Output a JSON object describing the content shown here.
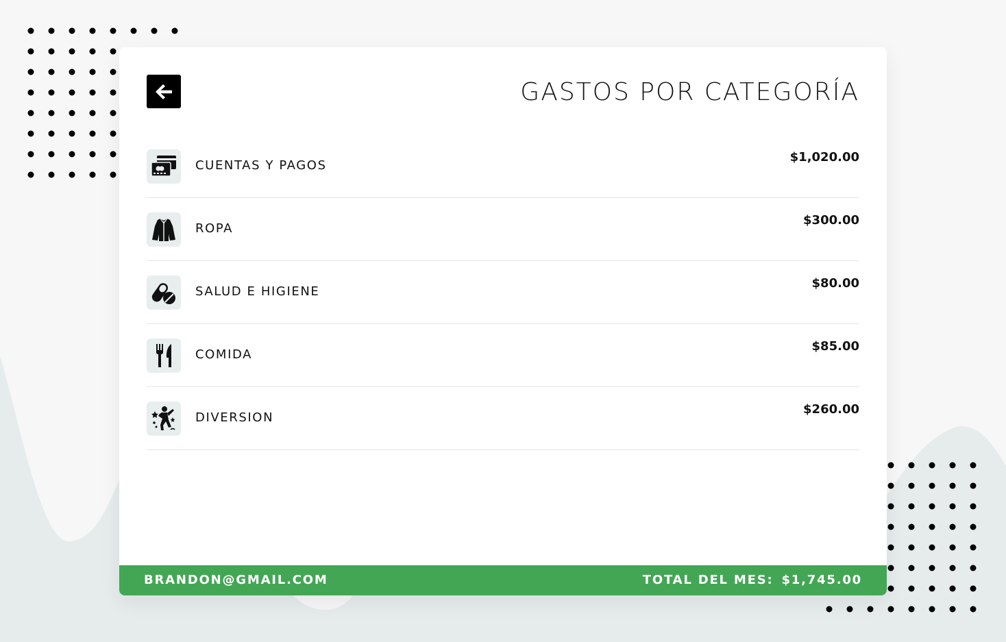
{
  "header": {
    "back_icon": "arrow-left-icon",
    "title": "GASTOS POR CATEGORÍA"
  },
  "categories": [
    {
      "icon": "bills-cards-icon",
      "label": "CUENTAS Y PAGOS",
      "amount": "$1,020.00"
    },
    {
      "icon": "jacket-icon",
      "label": "ROPA",
      "amount": "$300.00"
    },
    {
      "icon": "pills-icon",
      "label": "SALUD E HIGIENE",
      "amount": "$80.00"
    },
    {
      "icon": "fork-knife-icon",
      "label": "COMIDA",
      "amount": "$85.00"
    },
    {
      "icon": "dancing-person-icon",
      "label": "DIVERSION",
      "amount": "$260.00"
    }
  ],
  "footer": {
    "email": "BRANDON@GMAIL.COM",
    "total_label": "TOTAL DEL MES:",
    "total_value": "$1,745.00"
  },
  "colors": {
    "accent": "#43a655",
    "icon_bg": "#e8eeee",
    "background": "#f7f7f7"
  }
}
